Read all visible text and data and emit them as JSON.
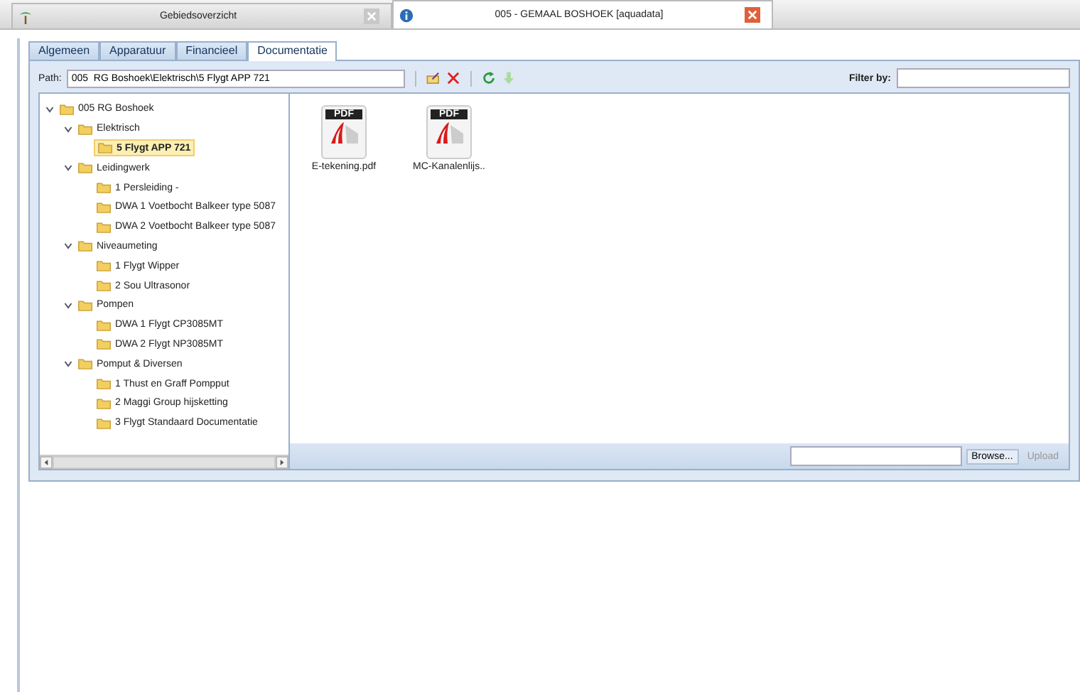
{
  "app_tabs": [
    {
      "title": "Gebiedsoverzicht",
      "selected": false
    },
    {
      "title": "005 - GEMAAL BOSHOEK [aquadata]",
      "selected": true
    }
  ],
  "tabs": [
    {
      "label": "Algemeen",
      "selected": false
    },
    {
      "label": "Apparatuur",
      "selected": false
    },
    {
      "label": "Financieel",
      "selected": false
    },
    {
      "label": "Documentatie",
      "selected": true
    }
  ],
  "toolbar": {
    "path_label": "Path:",
    "path_value": "005  RG Boshoek\\Elektrisch\\5 Flygt APP 721",
    "filter_label": "Filter by:"
  },
  "tree": [
    {
      "label": "005  RG Boshoek",
      "expanded": true,
      "selected": false,
      "children": [
        {
          "label": "Elektrisch",
          "expanded": true,
          "selected": false,
          "children": [
            {
              "label": "5 Flygt APP 721",
              "selected": true
            }
          ]
        },
        {
          "label": "Leidingwerk",
          "expanded": true,
          "selected": false,
          "children": [
            {
              "label": "1 Persleiding -",
              "selected": false
            },
            {
              "label": "DWA 1 Voetbocht Balkeer type 5087",
              "selected": false
            },
            {
              "label": "DWA 2 Voetbocht Balkeer type 5087",
              "selected": false
            }
          ]
        },
        {
          "label": "Niveaumeting",
          "expanded": true,
          "selected": false,
          "children": [
            {
              "label": "1 Flygt Wipper",
              "selected": false
            },
            {
              "label": "2 Sou Ultrasonor",
              "selected": false
            }
          ]
        },
        {
          "label": "Pompen",
          "expanded": true,
          "selected": false,
          "children": [
            {
              "label": "DWA 1 Flygt CP3085MT",
              "selected": false
            },
            {
              "label": "DWA 2 Flygt NP3085MT",
              "selected": false
            }
          ]
        },
        {
          "label": "Pomput & Diversen",
          "expanded": true,
          "selected": false,
          "children": [
            {
              "label": "1 Thust en Graff Pompput",
              "selected": false
            },
            {
              "label": "2 Maggi Group hijsketting",
              "selected": false
            },
            {
              "label": "3 Flygt Standaard Documentatie",
              "selected": false
            }
          ]
        }
      ]
    }
  ],
  "files": [
    {
      "name": "E-tekening.pdf",
      "icon_label": "PDF"
    },
    {
      "name": "MC-Kanalenlijs..",
      "icon_label": "PDF"
    }
  ],
  "upload": {
    "browse": "Browse...",
    "upload": "Upload",
    "upload_disabled": true
  }
}
